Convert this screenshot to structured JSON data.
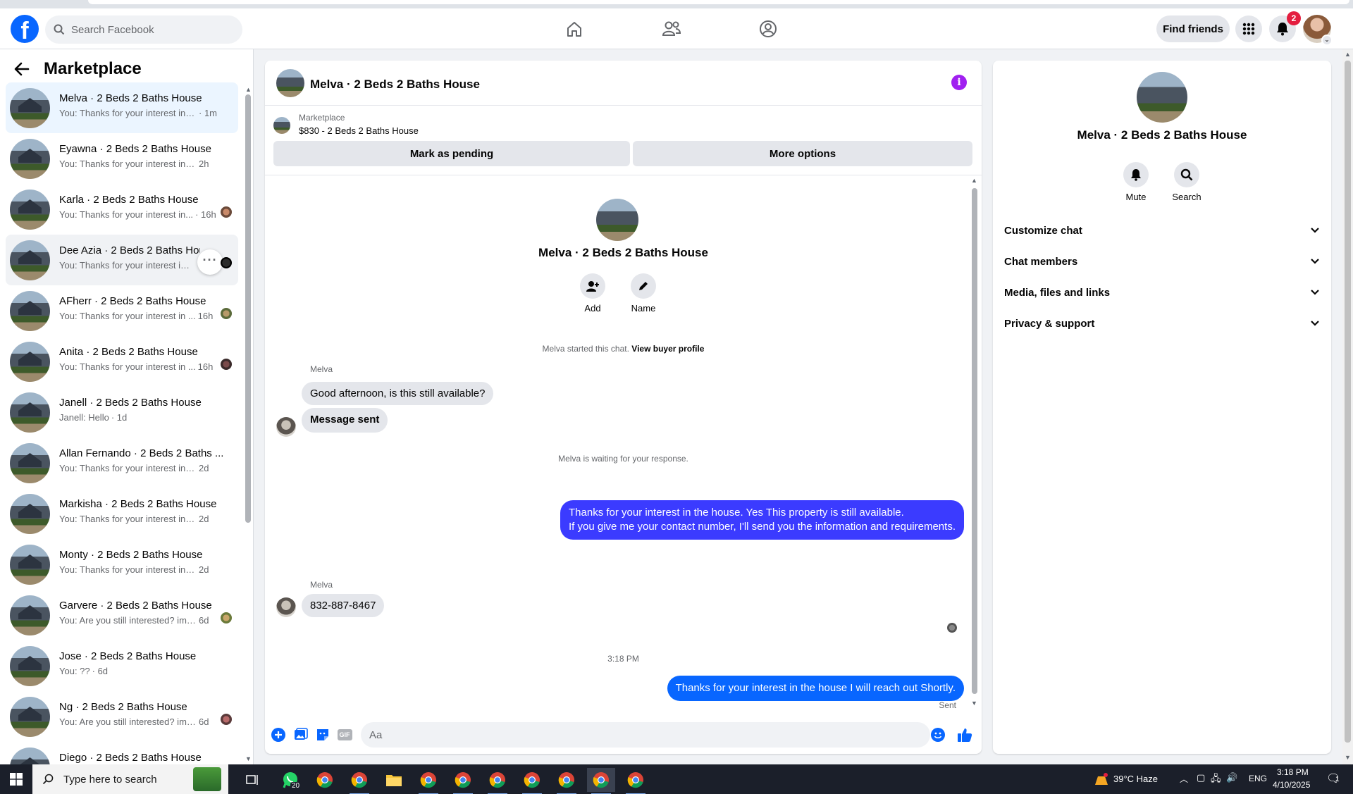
{
  "nav": {
    "search_placeholder": "Search Facebook",
    "find_friends_label": "Find friends",
    "notifications_count": "2"
  },
  "sidebar": {
    "title": "Marketplace",
    "conversations": [
      {
        "name": "Melva · 2 Beds 2 Baths House",
        "snippet": "You: Thanks for your interest in the...",
        "time": "· 1m",
        "state": "active"
      },
      {
        "name": "Eyawna · 2 Beds 2 Baths House",
        "snippet": "You: Thanks for your interest in the ...",
        "time": "2h",
        "state": ""
      },
      {
        "name": "Karla · 2 Beds 2 Baths House",
        "snippet": "You: Thanks for your interest in...",
        "time": "· 16h",
        "state": ""
      },
      {
        "name": "Dee Azia · 2 Beds 2 Baths House",
        "snippet": "You: Thanks for your interest in...",
        "time": "",
        "state": "hover"
      },
      {
        "name": "AFherr · 2 Beds 2 Baths House",
        "snippet": "You: Thanks for your interest in ...",
        "time": "16h",
        "state": ""
      },
      {
        "name": "Anita · 2 Beds 2 Baths House",
        "snippet": "You: Thanks for your interest in ...",
        "time": "16h",
        "state": ""
      },
      {
        "name": "Janell · 2 Beds 2 Baths House",
        "snippet": "Janell: Hello",
        "time": "· 1d",
        "state": ""
      },
      {
        "name": "Allan Fernando · 2 Beds 2 Baths ...",
        "snippet": "You: Thanks for your interest in the ...",
        "time": "2d",
        "state": ""
      },
      {
        "name": "Markisha · 2 Beds 2 Baths House",
        "snippet": "You: Thanks for your interest in the ...",
        "time": "2d",
        "state": ""
      },
      {
        "name": "Monty · 2 Beds 2 Baths House",
        "snippet": "You: Thanks for your interest in the ...",
        "time": "2d",
        "state": ""
      },
      {
        "name": "Garvere · 2 Beds 2 Baths House",
        "snippet": "You: Are you still interested? im ...",
        "time": "6d",
        "state": ""
      },
      {
        "name": "Jose · 2 Beds 2 Baths House",
        "snippet": "You: ??",
        "time": "· 6d",
        "state": ""
      },
      {
        "name": "Ng · 2 Beds 2 Baths House",
        "snippet": "You: Are you still interested? im ...",
        "time": "6d",
        "state": ""
      },
      {
        "name": "Diego · 2 Beds 2 Baths House",
        "snippet": "",
        "time": "",
        "state": ""
      }
    ]
  },
  "chat": {
    "title": "Melva · 2 Beds 2 Baths House",
    "listing_category": "Marketplace",
    "listing_price": "$830 - 2 Beds 2 Baths House",
    "mark_pending_label": "Mark as pending",
    "more_options_label": "More options",
    "intro_name": "Melva · 2 Beds 2 Baths House",
    "add_label": "Add",
    "name_label": "Name",
    "started_text": "Melva started this chat.",
    "view_buyer_label": "View buyer profile",
    "sender_1": "Melva",
    "msg_1": "Good afternoon, is this still available?",
    "msg_2": "Message sent",
    "waiting_text": "Melva is waiting for your response.",
    "out_msg_1_line1": "Thanks for your interest in the house. Yes This property is still available.",
    "out_msg_1_line2": "If you give me your contact number, I'll send you the information and requirements.",
    "sender_2": "Melva",
    "msg_3": "832-887-8467",
    "timestamp": "3:18 PM",
    "out_msg_2": "Thanks for your interest in the house I will reach out Shortly.",
    "sent_status": "Sent",
    "composer_placeholder": "Aa",
    "gif_label": "GIF"
  },
  "panel": {
    "name": "Melva · 2 Beds 2 Baths House",
    "mute_label": "Mute",
    "search_label": "Search",
    "sections": [
      "Customize chat",
      "Chat members",
      "Media, files and links",
      "Privacy & support"
    ]
  },
  "taskbar": {
    "search_placeholder": "Type here to search",
    "whatsapp_badge": "20",
    "weather": "39°C  Haze",
    "language": "ENG",
    "time": "3:18 PM",
    "date": "4/10/2025",
    "notif_count": "1"
  },
  "colors": {
    "facebook_blue": "#0866ff",
    "outgoing_bubble": "#3b3bff",
    "info_purple": "#a020f0",
    "badge_red": "#e41e3f"
  }
}
